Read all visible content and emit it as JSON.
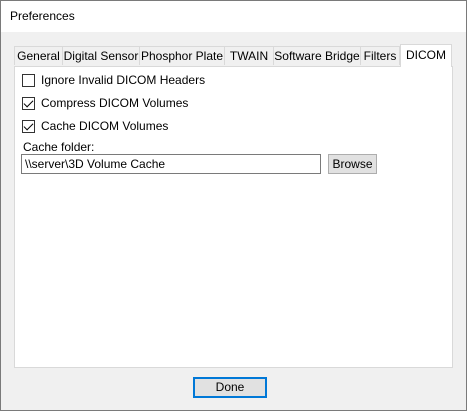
{
  "window": {
    "title": "Preferences"
  },
  "tabs": [
    {
      "label": "General",
      "active": false
    },
    {
      "label": "Digital Sensor",
      "active": false
    },
    {
      "label": "Phosphor Plate",
      "active": false
    },
    {
      "label": "TWAIN",
      "active": false
    },
    {
      "label": "Software Bridge",
      "active": false
    },
    {
      "label": "Filters",
      "active": false
    },
    {
      "label": "DICOM",
      "active": true
    }
  ],
  "dicom": {
    "ignore_invalid_headers": {
      "label": "Ignore Invalid DICOM Headers",
      "checked": false
    },
    "compress_volumes": {
      "label": "Compress DICOM Volumes",
      "checked": true
    },
    "cache_volumes": {
      "label": "Cache DICOM Volumes",
      "checked": true
    },
    "cache_folder": {
      "label": "Cache folder:",
      "value": "\\\\server\\3D Volume Cache",
      "browse_label": "Browse"
    }
  },
  "footer": {
    "done_label": "Done"
  },
  "colors": {
    "focus_border": "#0078d7",
    "panel_bg": "#ffffff",
    "dialog_bg": "#f0f0f0"
  }
}
